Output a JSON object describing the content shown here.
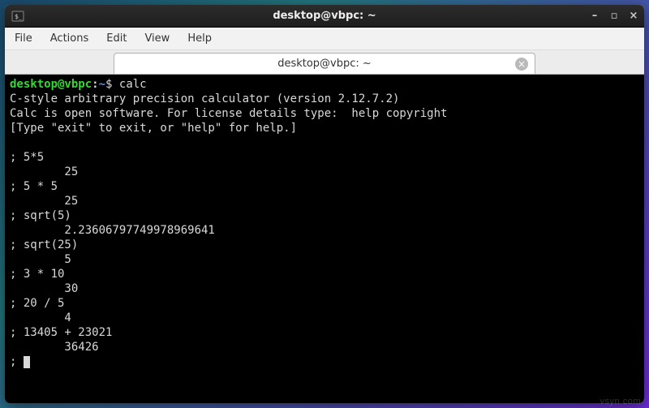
{
  "titlebar": {
    "title": "desktop@vbpc: ~",
    "minimize": "–",
    "maximize": "▫",
    "close": "×"
  },
  "menubar": {
    "file": "File",
    "actions": "Actions",
    "edit": "Edit",
    "view": "View",
    "help": "Help"
  },
  "tab": {
    "title": "desktop@vbpc: ~",
    "close": "×"
  },
  "prompt": {
    "user": "desktop@vbpc",
    "colon": ":",
    "path": "~",
    "symbol": "$ "
  },
  "command": "calc",
  "banner1": "C-style arbitrary precision calculator (version 2.12.7.2)",
  "banner2": "Calc is open software. For license details type:  help copyright",
  "banner3": "[Type \"exit\" to exit, or \"help\" for help.]",
  "lines": {
    "blank": "",
    "l1": "; 5*5",
    "r1": "        25",
    "l2": "; 5 * 5",
    "r2": "        25",
    "l3": "; sqrt(5)",
    "r3": "        2.23606797749978969641",
    "l4": "; sqrt(25)",
    "r4": "        5",
    "l5": "; 3 * 10",
    "r5": "        30",
    "l6": "; 20 / 5",
    "r6": "        4",
    "l7": "; 13405 + 23021",
    "r7": "        36426",
    "l8": "; "
  },
  "watermark": "vsyn com"
}
